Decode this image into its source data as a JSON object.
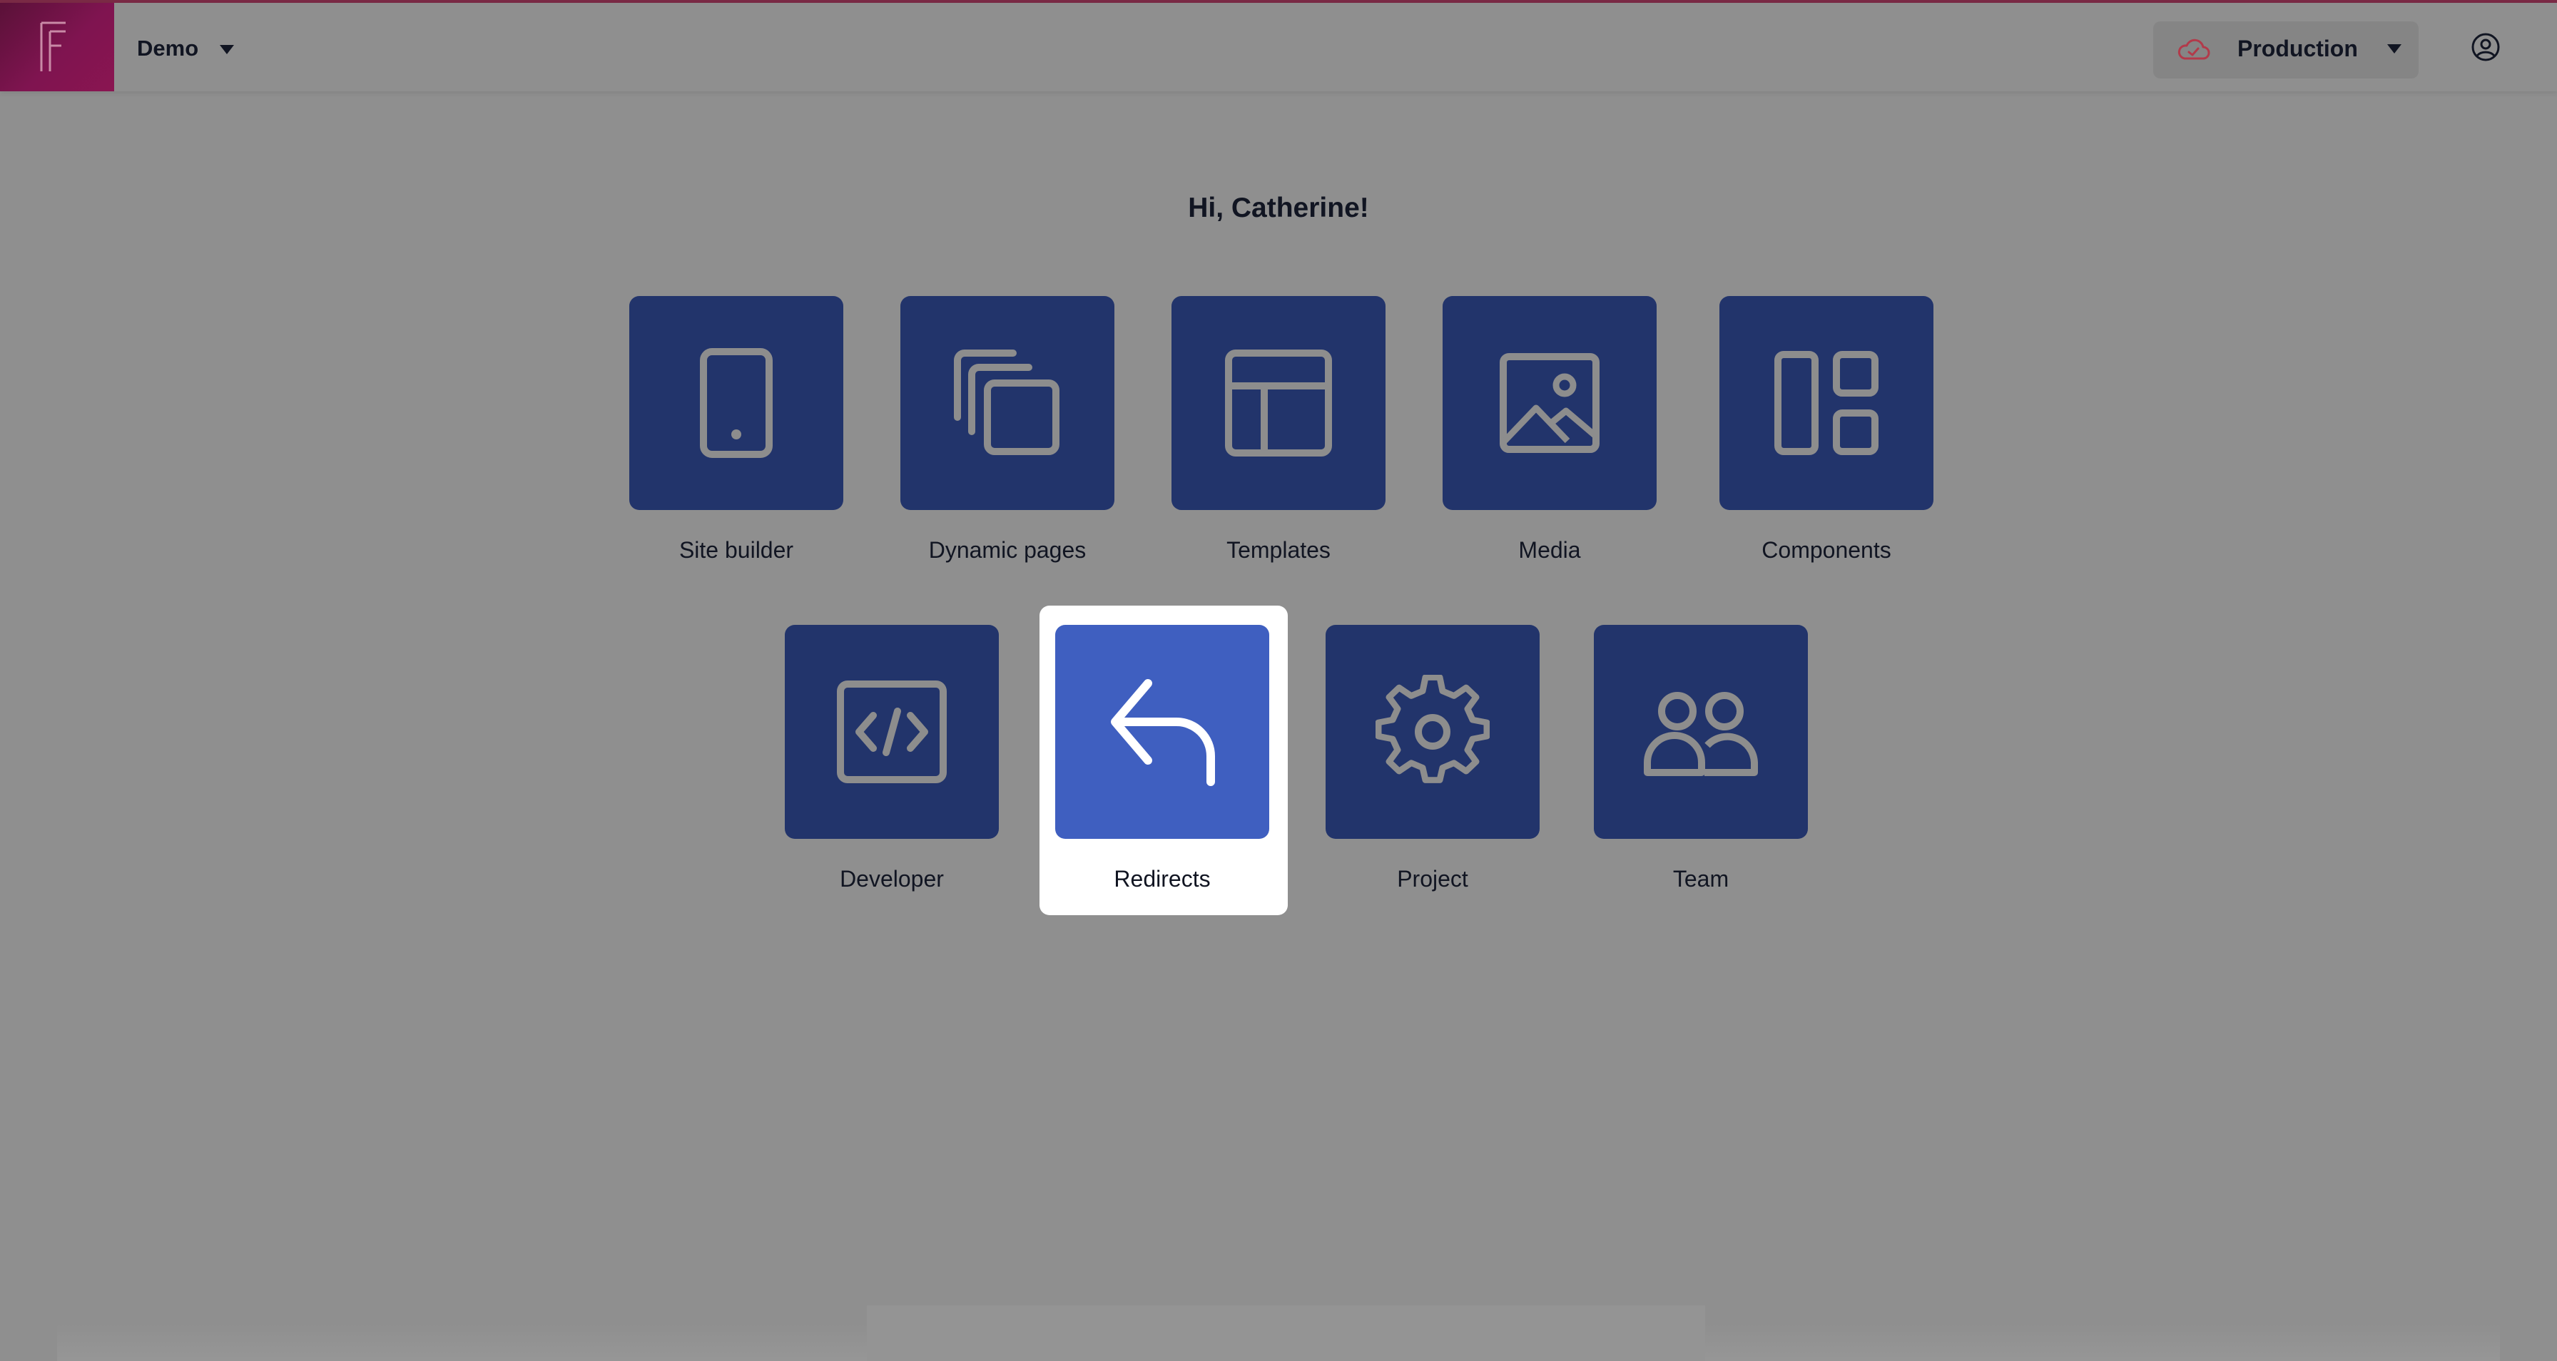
{
  "header": {
    "project_name": "Demo",
    "environment": "Production",
    "logo_letter": "F"
  },
  "greeting": "Hi, Catherine!",
  "tiles": [
    {
      "label": "Site builder",
      "icon": "tablet-icon"
    },
    {
      "label": "Dynamic pages",
      "icon": "stacked-pages-icon"
    },
    {
      "label": "Templates",
      "icon": "layout-template-icon"
    },
    {
      "label": "Media",
      "icon": "image-icon"
    },
    {
      "label": "Components",
      "icon": "components-grid-icon"
    },
    {
      "label": "Developer",
      "icon": "code-icon"
    },
    {
      "label": "Redirects",
      "icon": "redirect-arrow-icon",
      "selected": true
    },
    {
      "label": "Project",
      "icon": "gear-icon"
    },
    {
      "label": "Team",
      "icon": "team-icon"
    }
  ],
  "colors": {
    "tile": "#22346b",
    "tile_active": "#3f5fc0",
    "backdrop": "#8f8f8f",
    "brand": "#7f1450"
  }
}
